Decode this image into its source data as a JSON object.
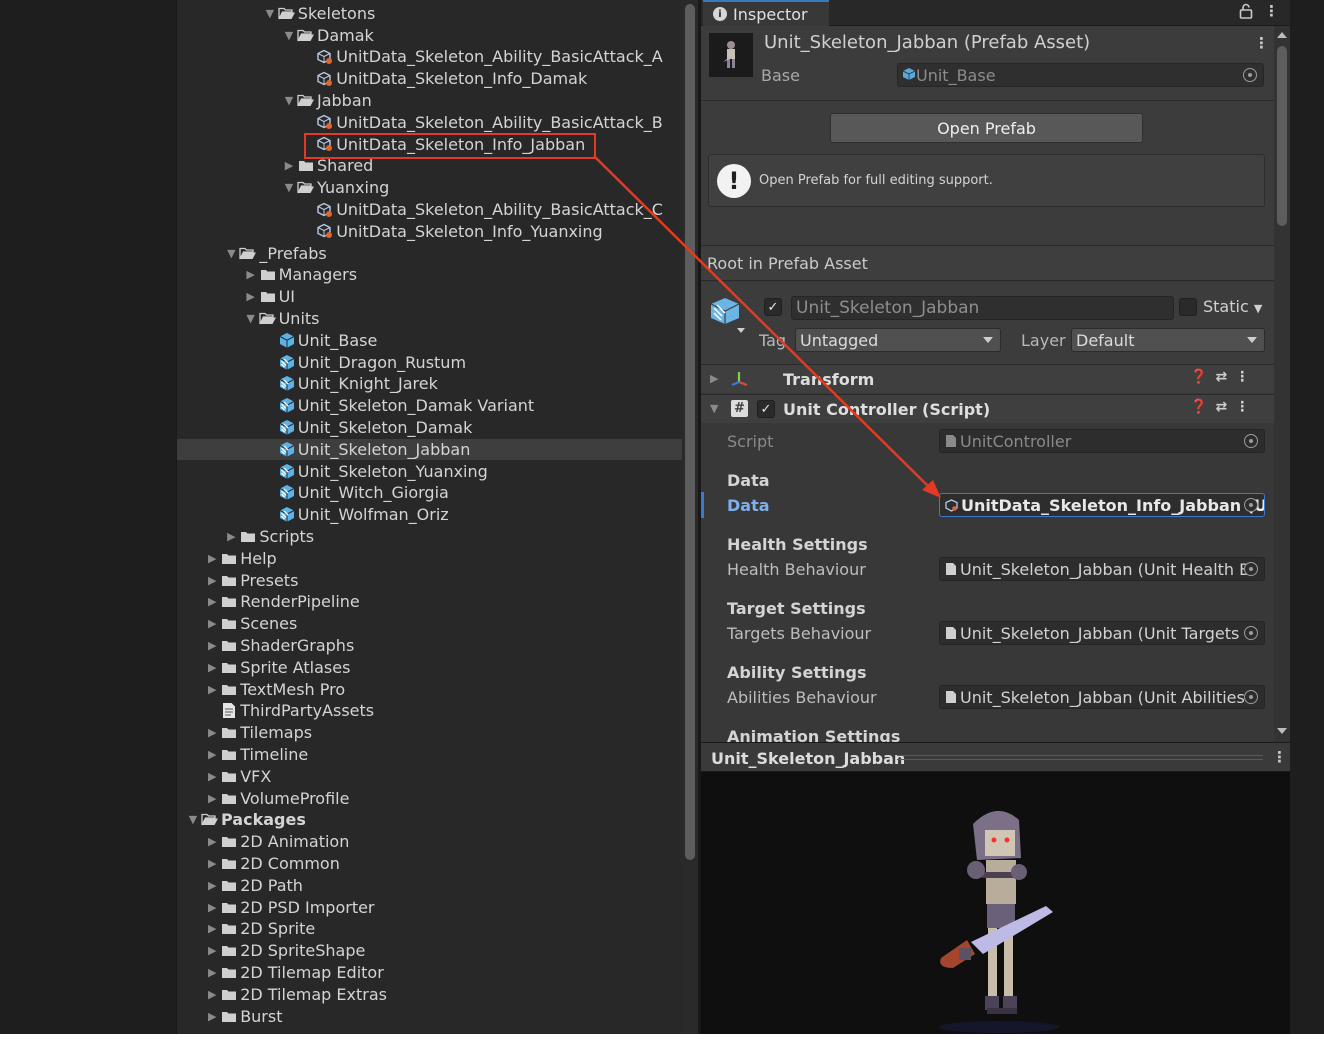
{
  "project": {
    "rows": [
      {
        "label": "Skeletons",
        "depth": 4,
        "arrow": "open",
        "icon": "folder-open",
        "icon_name": "folder-open-icon"
      },
      {
        "label": "Damak",
        "depth": 5,
        "arrow": "open",
        "icon": "folder-open",
        "icon_name": "folder-open-icon"
      },
      {
        "label": "UnitData_Skeleton_Ability_BasicAttack_A",
        "depth": 6,
        "arrow": "none",
        "icon": "scriptable",
        "icon_name": "scriptable-object-icon"
      },
      {
        "label": "UnitData_Skeleton_Info_Damak",
        "depth": 6,
        "arrow": "none",
        "icon": "scriptable",
        "icon_name": "scriptable-object-icon"
      },
      {
        "label": "Jabban",
        "depth": 5,
        "arrow": "open",
        "icon": "folder-open",
        "icon_name": "folder-open-icon"
      },
      {
        "label": "UnitData_Skeleton_Ability_BasicAttack_B",
        "depth": 6,
        "arrow": "none",
        "icon": "scriptable",
        "icon_name": "scriptable-object-icon"
      },
      {
        "label": "UnitData_Skeleton_Info_Jabban",
        "depth": 6,
        "arrow": "none",
        "icon": "scriptable",
        "icon_name": "scriptable-object-icon"
      },
      {
        "label": "Shared",
        "depth": 5,
        "arrow": "closed",
        "icon": "folder",
        "icon_name": "folder-icon"
      },
      {
        "label": "Yuanxing",
        "depth": 5,
        "arrow": "open",
        "icon": "folder-open",
        "icon_name": "folder-open-icon"
      },
      {
        "label": "UnitData_Skeleton_Ability_BasicAttack_C",
        "depth": 6,
        "arrow": "none",
        "icon": "scriptable",
        "icon_name": "scriptable-object-icon"
      },
      {
        "label": "UnitData_Skeleton_Info_Yuanxing",
        "depth": 6,
        "arrow": "none",
        "icon": "scriptable",
        "icon_name": "scriptable-object-icon"
      },
      {
        "label": "_Prefabs",
        "depth": 2,
        "arrow": "open",
        "icon": "folder-open",
        "icon_name": "folder-open-icon"
      },
      {
        "label": "Managers",
        "depth": 3,
        "arrow": "closed",
        "icon": "folder",
        "icon_name": "folder-icon"
      },
      {
        "label": "UI",
        "depth": 3,
        "arrow": "closed",
        "icon": "folder",
        "icon_name": "folder-icon"
      },
      {
        "label": "Units",
        "depth": 3,
        "arrow": "open",
        "icon": "folder-open",
        "icon_name": "folder-open-icon"
      },
      {
        "label": "Unit_Base",
        "depth": 4,
        "arrow": "none",
        "icon": "prefab",
        "icon_name": "prefab-icon"
      },
      {
        "label": "Unit_Dragon_Rustum",
        "depth": 4,
        "arrow": "none",
        "icon": "variant",
        "icon_name": "prefab-variant-icon"
      },
      {
        "label": "Unit_Knight_Jarek",
        "depth": 4,
        "arrow": "none",
        "icon": "variant",
        "icon_name": "prefab-variant-icon"
      },
      {
        "label": "Unit_Skeleton_Damak Variant",
        "depth": 4,
        "arrow": "none",
        "icon": "variant",
        "icon_name": "prefab-variant-icon"
      },
      {
        "label": "Unit_Skeleton_Damak",
        "depth": 4,
        "arrow": "none",
        "icon": "variant",
        "icon_name": "prefab-variant-icon"
      },
      {
        "label": "Unit_Skeleton_Jabban",
        "depth": 4,
        "arrow": "none",
        "icon": "variant",
        "icon_name": "prefab-variant-icon",
        "selected": true
      },
      {
        "label": "Unit_Skeleton_Yuanxing",
        "depth": 4,
        "arrow": "none",
        "icon": "variant",
        "icon_name": "prefab-variant-icon"
      },
      {
        "label": "Unit_Witch_Giorgia",
        "depth": 4,
        "arrow": "none",
        "icon": "variant",
        "icon_name": "prefab-variant-icon"
      },
      {
        "label": "Unit_Wolfman_Oriz",
        "depth": 4,
        "arrow": "none",
        "icon": "variant",
        "icon_name": "prefab-variant-icon"
      },
      {
        "label": "Scripts",
        "depth": 2,
        "arrow": "closed",
        "icon": "folder",
        "icon_name": "folder-icon"
      },
      {
        "label": "Help",
        "depth": 1,
        "arrow": "closed",
        "icon": "folder",
        "icon_name": "folder-icon"
      },
      {
        "label": "Presets",
        "depth": 1,
        "arrow": "closed",
        "icon": "folder",
        "icon_name": "folder-icon"
      },
      {
        "label": "RenderPipeline",
        "depth": 1,
        "arrow": "closed",
        "icon": "folder",
        "icon_name": "folder-icon"
      },
      {
        "label": "Scenes",
        "depth": 1,
        "arrow": "closed",
        "icon": "folder",
        "icon_name": "folder-icon"
      },
      {
        "label": "ShaderGraphs",
        "depth": 1,
        "arrow": "closed",
        "icon": "folder",
        "icon_name": "folder-icon"
      },
      {
        "label": "Sprite Atlases",
        "depth": 1,
        "arrow": "closed",
        "icon": "folder",
        "icon_name": "folder-icon"
      },
      {
        "label": "TextMesh Pro",
        "depth": 1,
        "arrow": "closed",
        "icon": "folder",
        "icon_name": "folder-icon"
      },
      {
        "label": "ThirdPartyAssets",
        "depth": 1,
        "arrow": "none",
        "icon": "file",
        "icon_name": "text-file-icon"
      },
      {
        "label": "Tilemaps",
        "depth": 1,
        "arrow": "closed",
        "icon": "folder",
        "icon_name": "folder-icon"
      },
      {
        "label": "Timeline",
        "depth": 1,
        "arrow": "closed",
        "icon": "folder",
        "icon_name": "folder-icon"
      },
      {
        "label": "VFX",
        "depth": 1,
        "arrow": "closed",
        "icon": "folder",
        "icon_name": "folder-icon"
      },
      {
        "label": "VolumeProfile",
        "depth": 1,
        "arrow": "closed",
        "icon": "folder",
        "icon_name": "folder-icon"
      },
      {
        "label": "Packages",
        "depth": 0,
        "arrow": "open",
        "icon": "folder-open",
        "icon_name": "folder-open-icon",
        "bold": true
      },
      {
        "label": "2D Animation",
        "depth": 1,
        "arrow": "closed",
        "icon": "folder",
        "icon_name": "folder-icon"
      },
      {
        "label": "2D Common",
        "depth": 1,
        "arrow": "closed",
        "icon": "folder",
        "icon_name": "folder-icon"
      },
      {
        "label": "2D Path",
        "depth": 1,
        "arrow": "closed",
        "icon": "folder",
        "icon_name": "folder-icon"
      },
      {
        "label": "2D PSD Importer",
        "depth": 1,
        "arrow": "closed",
        "icon": "folder",
        "icon_name": "folder-icon"
      },
      {
        "label": "2D Sprite",
        "depth": 1,
        "arrow": "closed",
        "icon": "folder",
        "icon_name": "folder-icon"
      },
      {
        "label": "2D SpriteShape",
        "depth": 1,
        "arrow": "closed",
        "icon": "folder",
        "icon_name": "folder-icon"
      },
      {
        "label": "2D Tilemap Editor",
        "depth": 1,
        "arrow": "closed",
        "icon": "folder",
        "icon_name": "folder-icon"
      },
      {
        "label": "2D Tilemap Extras",
        "depth": 1,
        "arrow": "closed",
        "icon": "folder",
        "icon_name": "folder-icon"
      },
      {
        "label": "Burst",
        "depth": 1,
        "arrow": "closed",
        "icon": "folder",
        "icon_name": "folder-icon"
      }
    ]
  },
  "inspector": {
    "tab_label": "Inspector",
    "prefab_title": "Unit_Skeleton_Jabban (Prefab Asset)",
    "base_label": "Base",
    "base_value": "Unit_Base",
    "open_prefab_button": "Open Prefab",
    "help_text": "Open Prefab for full editing support.",
    "root_label": "Root in Prefab Asset",
    "gameobject_name": "Unit_Skeleton_Jabban",
    "gameobject_active": true,
    "static_label": "Static",
    "static_checked": false,
    "tag_label": "Tag",
    "tag_value": "Untagged",
    "layer_label": "Layer",
    "layer_value": "Default",
    "transform_label": "Transform",
    "unit_controller_label": "Unit Controller (Script)",
    "unit_controller_enabled": true,
    "script_label": "Script",
    "script_value": "UnitController",
    "data_section": "Data",
    "data_label": "Data",
    "data_value": "UnitData_Skeleton_Info_Jabban (U",
    "health_section": "Health Settings",
    "health_label": "Health Behaviour",
    "health_value": "Unit_Skeleton_Jabban (Unit Health B",
    "target_section": "Target Settings",
    "target_label": "Targets Behaviour",
    "target_value": "Unit_Skeleton_Jabban (Unit Targets",
    "ability_section": "Ability Settings",
    "ability_label": "Abilities Behaviour",
    "ability_value": "Unit_Skeleton_Jabban (Unit Abilities",
    "animation_section": "Animation Settings"
  },
  "preview": {
    "title": "Unit_Skeleton_Jabban"
  },
  "colors": {
    "annotation_red": "#e23a23",
    "focus_blue": "#3b7ad0",
    "selection_row": "#3e3e3e"
  }
}
